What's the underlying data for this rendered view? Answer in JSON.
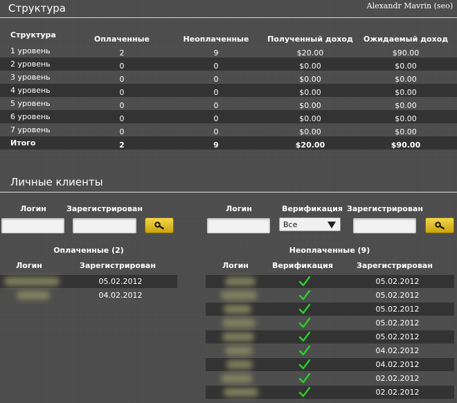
{
  "header": {
    "title": "Структура",
    "user": "Alexandr Mavrin (seo)"
  },
  "structure": {
    "columns": [
      "Структура",
      "Оплаченные",
      "Неоплаченные",
      "Полученный доход",
      "Ожидаемый доход"
    ],
    "rows": [
      {
        "level": "1 уровень",
        "paid": "2",
        "unpaid": "9",
        "received": "$20.00",
        "expected": "$90.00"
      },
      {
        "level": "2 уровень",
        "paid": "0",
        "unpaid": "0",
        "received": "$0.00",
        "expected": "$0.00"
      },
      {
        "level": "3 уровень",
        "paid": "0",
        "unpaid": "0",
        "received": "$0.00",
        "expected": "$0.00"
      },
      {
        "level": "4 уровень",
        "paid": "0",
        "unpaid": "0",
        "received": "$0.00",
        "expected": "$0.00"
      },
      {
        "level": "5 уровень",
        "paid": "0",
        "unpaid": "0",
        "received": "$0.00",
        "expected": "$0.00"
      },
      {
        "level": "6 уровень",
        "paid": "0",
        "unpaid": "0",
        "received": "$0.00",
        "expected": "$0.00"
      },
      {
        "level": "7 уровень",
        "paid": "0",
        "unpaid": "0",
        "received": "$0.00",
        "expected": "$0.00"
      }
    ],
    "total": {
      "level": "Итого",
      "paid": "2",
      "unpaid": "9",
      "received": "$20.00",
      "expected": "$90.00"
    }
  },
  "clients": {
    "title": "Личные клиенты",
    "paid_filter": {
      "login_label": "Логин",
      "registered_label": "Зарегистрирован",
      "login_value": "",
      "registered_value": ""
    },
    "unpaid_filter": {
      "login_label": "Логин",
      "verification_label": "Верификация",
      "registered_label": "Зарегистрирован",
      "verification_value": "Все",
      "login_value": "",
      "registered_value": ""
    },
    "paid": {
      "title": "Оплаченные (2)",
      "columns": [
        "Логин",
        "Зарегистрирован"
      ],
      "rows": [
        {
          "date": "05.02.2012"
        },
        {
          "date": "04.02.2012"
        }
      ]
    },
    "unpaid": {
      "title": "Неоплаченные (9)",
      "columns": [
        "Логин",
        "Верификация",
        "Зарегистрирован"
      ],
      "rows": [
        {
          "verified": true,
          "date": "05.02.2012"
        },
        {
          "verified": true,
          "date": "05.02.2012"
        },
        {
          "verified": true,
          "date": "05.02.2012"
        },
        {
          "verified": true,
          "date": "05.02.2012"
        },
        {
          "verified": true,
          "date": "05.02.2012"
        },
        {
          "verified": true,
          "date": "04.02.2012"
        },
        {
          "verified": true,
          "date": "04.02.2012"
        },
        {
          "verified": true,
          "date": "02.02.2012"
        },
        {
          "verified": true,
          "date": "02.02.2012"
        }
      ]
    }
  },
  "icons": {
    "search": "magnifier-icon",
    "check": "checkmark-icon",
    "dropdown": "triangle-down-icon"
  },
  "colors": {
    "accent": "#e0bd1f",
    "check": "#2bd02b",
    "row_dark": "#333333",
    "background": "#505050"
  }
}
